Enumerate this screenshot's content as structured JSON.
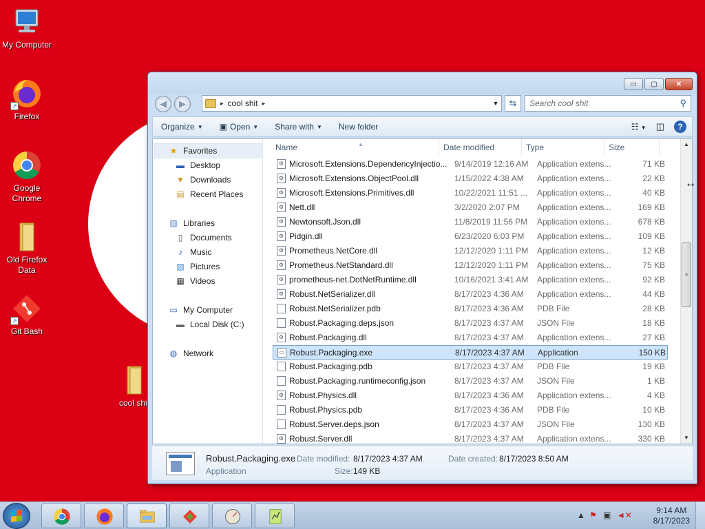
{
  "desktop": {
    "icons": [
      {
        "label": "My Computer"
      },
      {
        "label": "Firefox"
      },
      {
        "label": "Google Chrome"
      },
      {
        "label": "Old Firefox Data"
      },
      {
        "label": "Git Bash"
      },
      {
        "label": "cool shit"
      }
    ],
    "colors": {
      "background": "#dc0014",
      "circle": "#ffffff"
    }
  },
  "window": {
    "caption_buttons": {
      "minimize": "▭",
      "maximize": "▢",
      "close": "✕"
    },
    "back_glyph": "◀",
    "forward_glyph": "▶",
    "breadcrumb": "cool shit",
    "search_placeholder": "Search cool shit",
    "toolbar": {
      "organize": "Organize",
      "open": "Open",
      "share_with": "Share with",
      "new_folder": "New folder"
    },
    "nav": {
      "favorites": "Favorites",
      "desktop": "Desktop",
      "downloads": "Downloads",
      "recent_places": "Recent Places",
      "libraries": "Libraries",
      "documents": "Documents",
      "music": "Music",
      "pictures": "Pictures",
      "videos": "Videos",
      "my_computer": "My Computer",
      "local_disk": "Local Disk (C:)",
      "network": "Network"
    },
    "columns": {
      "name": "Name",
      "date_modified": "Date modified",
      "type": "Type",
      "size": "Size"
    },
    "files": [
      {
        "name": "Microsoft.Extensions.DependencyInjectio...",
        "date": "9/14/2019 12:16 AM",
        "type": "Application extens...",
        "size": "71 KB",
        "icon": "dll"
      },
      {
        "name": "Microsoft.Extensions.ObjectPool.dll",
        "date": "1/15/2022 4:38 AM",
        "type": "Application extens...",
        "size": "22 KB",
        "icon": "dll"
      },
      {
        "name": "Microsoft.Extensions.Primitives.dll",
        "date": "10/22/2021 11:51 ...",
        "type": "Application extens...",
        "size": "40 KB",
        "icon": "dll"
      },
      {
        "name": "Nett.dll",
        "date": "3/2/2020 2:07 PM",
        "type": "Application extens...",
        "size": "169 KB",
        "icon": "dll"
      },
      {
        "name": "Newtonsoft.Json.dll",
        "date": "11/8/2019 11:56 PM",
        "type": "Application extens...",
        "size": "678 KB",
        "icon": "dll"
      },
      {
        "name": "Pidgin.dll",
        "date": "6/23/2020 6:03 PM",
        "type": "Application extens...",
        "size": "109 KB",
        "icon": "dll"
      },
      {
        "name": "Prometheus.NetCore.dll",
        "date": "12/12/2020 1:11 PM",
        "type": "Application extens...",
        "size": "12 KB",
        "icon": "dll"
      },
      {
        "name": "Prometheus.NetStandard.dll",
        "date": "12/12/2020 1:11 PM",
        "type": "Application extens...",
        "size": "75 KB",
        "icon": "dll"
      },
      {
        "name": "prometheus-net.DotNetRuntime.dll",
        "date": "10/16/2021 3:41 AM",
        "type": "Application extens...",
        "size": "92 KB",
        "icon": "dll"
      },
      {
        "name": "Robust.NetSerializer.dll",
        "date": "8/17/2023 4:36 AM",
        "type": "Application extens...",
        "size": "44 KB",
        "icon": "dll"
      },
      {
        "name": "Robust.NetSerializer.pdb",
        "date": "8/17/2023 4:36 AM",
        "type": "PDB File",
        "size": "28 KB",
        "icon": "file"
      },
      {
        "name": "Robust.Packaging.deps.json",
        "date": "8/17/2023 4:37 AM",
        "type": "JSON File",
        "size": "18 KB",
        "icon": "file"
      },
      {
        "name": "Robust.Packaging.dll",
        "date": "8/17/2023 4:37 AM",
        "type": "Application extens...",
        "size": "27 KB",
        "icon": "dll"
      },
      {
        "name": "Robust.Packaging.exe",
        "date": "8/17/2023 4:37 AM",
        "type": "Application",
        "size": "150 KB",
        "icon": "exe",
        "selected": true
      },
      {
        "name": "Robust.Packaging.pdb",
        "date": "8/17/2023 4:37 AM",
        "type": "PDB File",
        "size": "19 KB",
        "icon": "file"
      },
      {
        "name": "Robust.Packaging.runtimeconfig.json",
        "date": "8/17/2023 4:37 AM",
        "type": "JSON File",
        "size": "1 KB",
        "icon": "file"
      },
      {
        "name": "Robust.Physics.dll",
        "date": "8/17/2023 4:36 AM",
        "type": "Application extens...",
        "size": "4 KB",
        "icon": "dll"
      },
      {
        "name": "Robust.Physics.pdb",
        "date": "8/17/2023 4:36 AM",
        "type": "PDB File",
        "size": "10 KB",
        "icon": "file"
      },
      {
        "name": "Robust.Server.deps.json",
        "date": "8/17/2023 4:37 AM",
        "type": "JSON File",
        "size": "130 KB",
        "icon": "file"
      },
      {
        "name": "Robust.Server.dll",
        "date": "8/17/2023 4:37 AM",
        "type": "Application extens...",
        "size": "330 KB",
        "icon": "dll"
      }
    ],
    "details": {
      "filename": "Robust.Packaging.exe",
      "type": "Application",
      "date_modified_label": "Date modified:",
      "date_modified": "8/17/2023 4:37 AM",
      "date_created_label": "Date created:",
      "date_created": "8/17/2023 8:50 AM",
      "size_label": "Size:",
      "size": "149 KB"
    }
  },
  "taskbar": {
    "apps": [
      {
        "icon": "chrome-icon"
      },
      {
        "icon": "firefox-icon"
      },
      {
        "icon": "explorer-icon",
        "active": true
      },
      {
        "icon": "git-icon"
      },
      {
        "icon": "gauge-icon"
      },
      {
        "icon": "notepad-icon"
      }
    ],
    "clock": {
      "time": "9:14 AM",
      "date": "8/17/2023"
    }
  }
}
